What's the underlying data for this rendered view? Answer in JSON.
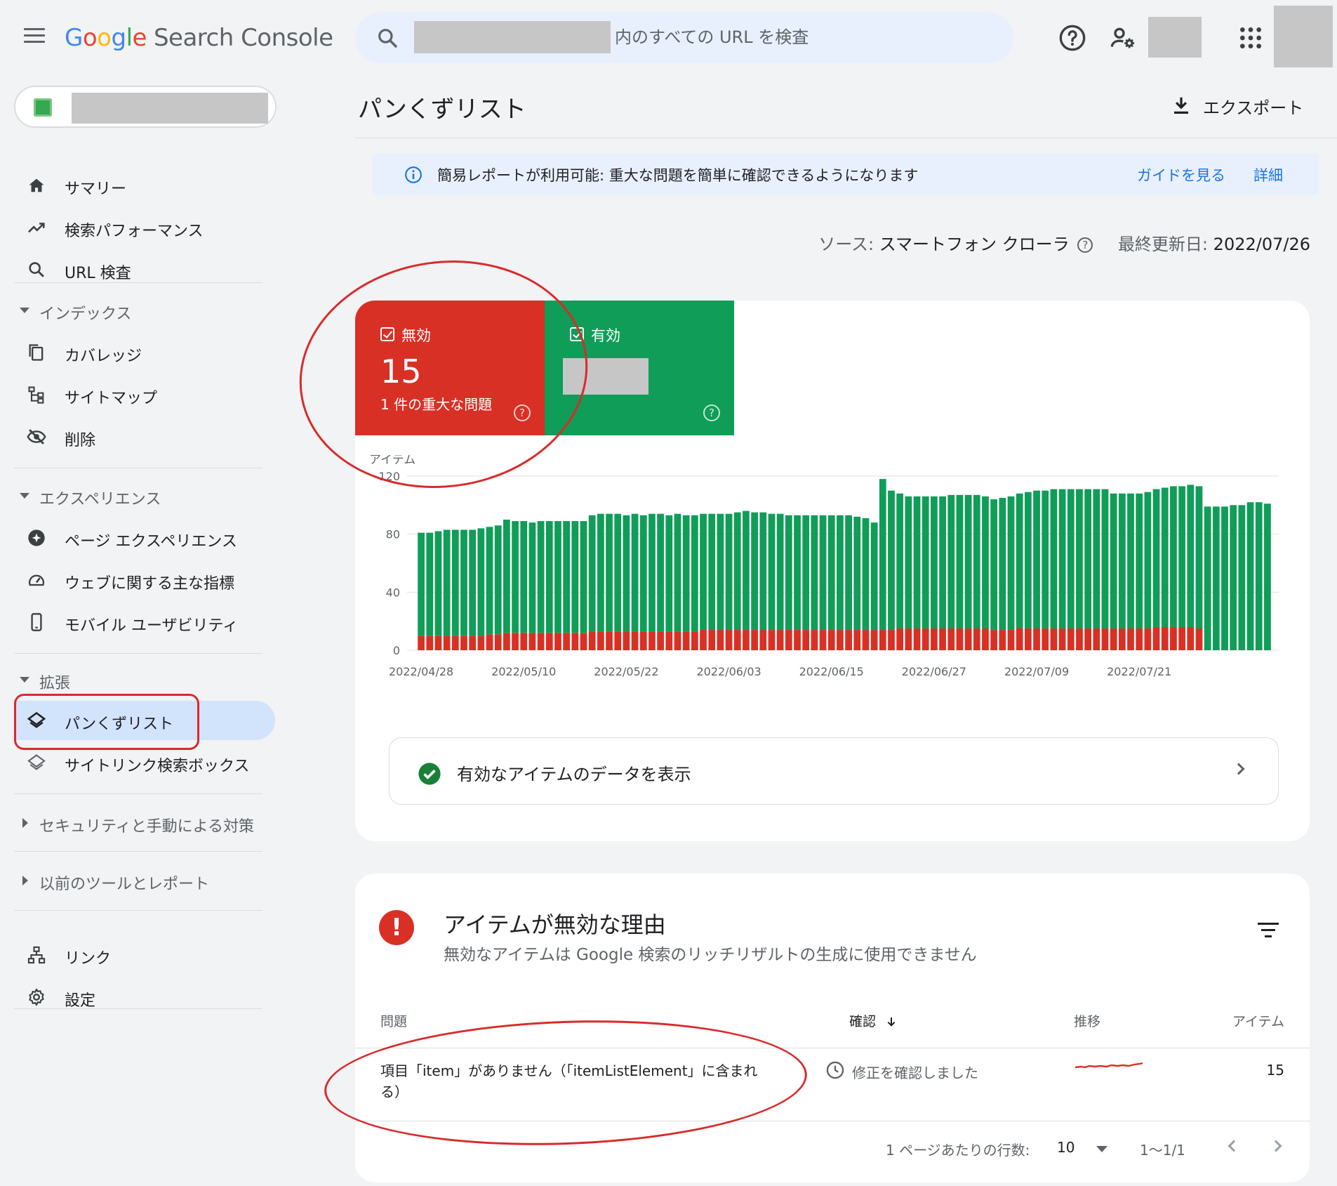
{
  "app": {
    "logo": [
      "G",
      "o",
      "o",
      "g",
      "l",
      "e"
    ],
    "product": "Search Console"
  },
  "search": {
    "placeholder": "内のすべての URL を検査"
  },
  "sidebar": {
    "top_items": [
      {
        "label": "サマリー",
        "icon": "home-icon"
      },
      {
        "label": "検索パフォーマンス",
        "icon": "trending-up-icon"
      },
      {
        "label": "URL 検査",
        "icon": "search-icon"
      }
    ],
    "index_section": "インデックス",
    "index_items": [
      {
        "label": "カバレッジ",
        "icon": "copy-icon"
      },
      {
        "label": "サイトマップ",
        "icon": "sitemap-icon"
      },
      {
        "label": "削除",
        "icon": "eye-off-icon"
      }
    ],
    "experience_section": "エクスペリエンス",
    "experience_items": [
      {
        "label": "ページ エクスペリエンス",
        "icon": "plus-circle-icon"
      },
      {
        "label": "ウェブに関する主な指標",
        "icon": "speedometer-icon"
      },
      {
        "label": "モバイル ユーザビリティ",
        "icon": "smartphone-icon"
      }
    ],
    "enhancements_section": "拡張",
    "enhancement_items": [
      {
        "label": "パンくずリスト",
        "icon": "layers-icon"
      },
      {
        "label": "サイトリンク検索ボックス",
        "icon": "layers-outline-icon"
      }
    ],
    "security_section": "セキュリティと手動による対策",
    "legacy_section": "以前のツールとレポート",
    "bottom_items": [
      {
        "label": "リンク",
        "icon": "network-icon"
      },
      {
        "label": "設定",
        "icon": "gear-icon"
      }
    ]
  },
  "main": {
    "title": "パンくずリスト",
    "export_label": "エクスポート",
    "banner": {
      "message": "簡易レポートが利用可能: 重大な問題を簡単に確認できるようになります",
      "guide_link": "ガイドを見る",
      "details_link": "詳細"
    },
    "source_label": "ソース:",
    "source_value": "スマートフォン クローラ",
    "updated_label": "最終更新日:",
    "updated_value": "2022/07/26",
    "help_glyph": "?",
    "tiles": {
      "invalid_label": "無効",
      "invalid_count": "15",
      "invalid_sub": "1 件の重大な問題",
      "valid_label": "有効"
    },
    "valid_link_label": "有効なアイテムのデータを表示",
    "reasons": {
      "alert_glyph": "!",
      "title": "アイテムが無効な理由",
      "subtitle": "無効なアイテムは Google 検索のリッチリザルトの生成に使用できません",
      "columns": [
        "問題",
        "確認",
        "推移",
        "アイテム"
      ],
      "rows": [
        {
          "issue": "項目「item」がありません（「itemListElement」に含まれる）",
          "verify": "修正を確認しました",
          "count": "15"
        }
      ],
      "rows_per_page_label": "1 ページあたりの行数:",
      "rows_per_page_value": "10",
      "range": "1～1/1"
    }
  },
  "colors": {
    "invalid": "#d93025",
    "valid": "#0f9d58",
    "accent": "#1a73e8",
    "annotation": "#d92b2b"
  },
  "chart_data": {
    "type": "bar",
    "stacked": true,
    "ylabel": "アイテム",
    "ylim": [
      0,
      120
    ],
    "yticks": [
      0,
      40,
      80,
      120
    ],
    "x_tick_labels": [
      "2022/04/28",
      "2022/05/10",
      "2022/05/22",
      "2022/06/03",
      "2022/06/15",
      "2022/06/27",
      "2022/07/09",
      "2022/07/21"
    ],
    "x_start": "2022/04/28",
    "x_end": "2022/07/26",
    "series": [
      {
        "name": "無効",
        "color": "#d93025",
        "values": [
          10,
          10,
          10,
          10,
          10,
          10,
          10,
          10,
          11,
          11,
          12,
          12,
          12,
          12,
          12,
          12,
          12,
          12,
          12,
          12,
          13,
          13,
          13,
          13,
          13,
          13,
          13,
          13,
          13,
          13,
          13,
          13,
          13,
          14,
          14,
          14,
          14,
          14,
          14,
          14,
          14,
          14,
          14,
          14,
          14,
          14,
          14,
          14,
          14,
          14,
          14,
          14,
          14,
          14,
          14,
          14,
          15,
          15,
          15,
          15,
          15,
          15,
          15,
          15,
          15,
          15,
          15,
          14,
          14,
          14,
          15,
          15,
          15,
          15,
          15,
          15,
          15,
          15,
          15,
          15,
          15,
          15,
          15,
          15,
          15,
          15,
          16,
          16,
          16,
          16,
          16,
          15
        ]
      },
      {
        "name": "有効",
        "color": "#0f9d58",
        "values": [
          71,
          71,
          72,
          73,
          73,
          73,
          73,
          74,
          74,
          75,
          78,
          77,
          77,
          76,
          77,
          77,
          77,
          77,
          77,
          77,
          80,
          81,
          81,
          81,
          80,
          81,
          80,
          81,
          81,
          80,
          81,
          80,
          80,
          80,
          80,
          80,
          80,
          81,
          82,
          81,
          81,
          80,
          80,
          79,
          79,
          79,
          79,
          79,
          79,
          79,
          79,
          78,
          77,
          74,
          104,
          96,
          93,
          91,
          91,
          91,
          91,
          91,
          92,
          92,
          92,
          92,
          91,
          90,
          91,
          92,
          93,
          94,
          95,
          95,
          96,
          96,
          96,
          96,
          96,
          96,
          96,
          93,
          93,
          93,
          93,
          94,
          95,
          96,
          97,
          97,
          98,
          98,
          99,
          99,
          99,
          100,
          100,
          102,
          102,
          101
        ]
      }
    ]
  }
}
